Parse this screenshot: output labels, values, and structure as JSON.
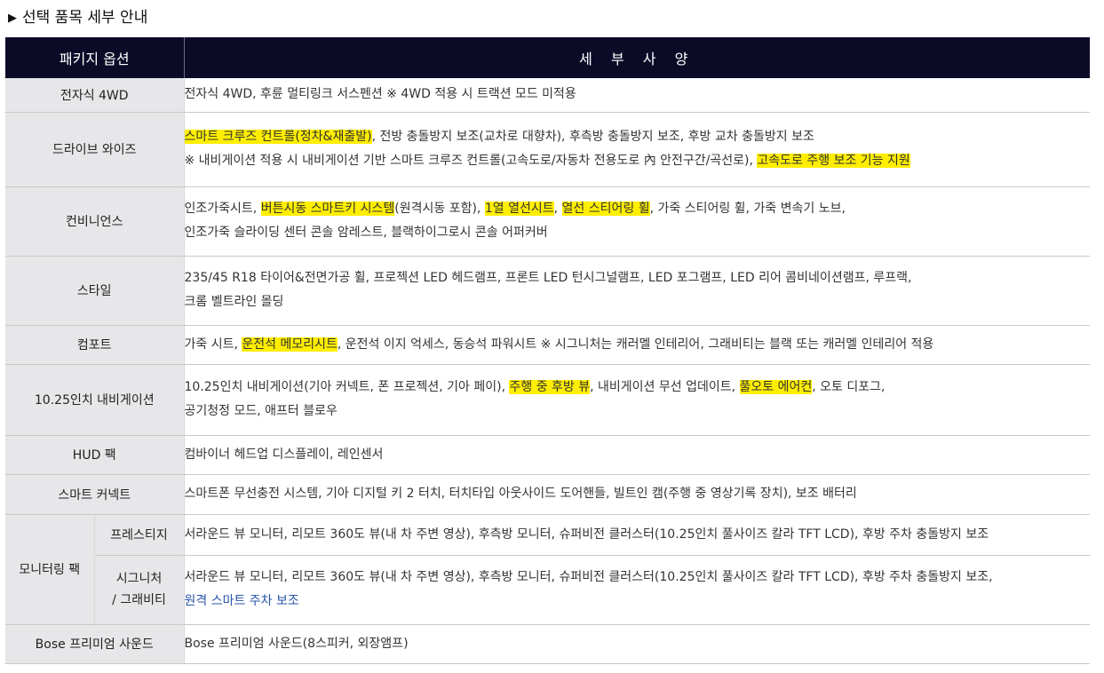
{
  "title": "선택 품목 세부 안내",
  "header": {
    "option": "패키지 옵션",
    "spec": "세 부 사 양"
  },
  "rows": {
    "r1": {
      "name": "전자식 4WD",
      "l1": "전자식 4WD, 후륜 멀티링크 서스펜션  ※ 4WD 적용 시 트랙션 모드 미적용"
    },
    "r2": {
      "name": "드라이브 와이즈",
      "l1a": "스마트 크루즈 컨트롤(정차&재출발)",
      "l1b": ", 전방 충돌방지 보조(교차로 대향차), 후측방 충돌방지 보조, 후방 교차 충돌방지 보조",
      "l2a": "※ 내비게이션 적용 시 내비게이션 기반 스마트 크루즈 컨트롤(고속도로/자동차 전용도로 內 안전구간/곡선로), ",
      "l2b": "고속도로 주행 보조 기능 지원"
    },
    "r3": {
      "name": "컨비니언스",
      "l1a": "인조가죽시트, ",
      "l1b": "버튼시동 스마트키 시스템",
      "l1c": "(원격시동 포함), ",
      "l1d": "1열 열선시트",
      "l1e": ", ",
      "l1f": "열선 스티어링 휠",
      "l1g": ", 가죽 스티어링 휠, 가죽 변속기 노브,",
      "l2": "인조가죽 슬라이딩 센터 콘솔 암레스트, 블랙하이그로시 콘솔 어퍼커버"
    },
    "r4": {
      "name": "스타일",
      "l1": "235/45 R18 타이어&전면가공 휠, 프로젝션 LED 헤드램프, 프론트 LED 턴시그널램프, LED 포그램프, LED 리어 콤비네이션램프, 루프랙,",
      "l2": "크롬 벨트라인 몰딩"
    },
    "r5": {
      "name": "컴포트",
      "l1a": "가죽 시트, ",
      "l1b": "운전석 메모리시트",
      "l1c": ", 운전석 이지 억세스, 동승석 파워시트  ※ 시그니처는 캐러멜 인테리어, 그래비티는 블랙 또는 캐러멜 인테리어 적용"
    },
    "r6": {
      "name": "10.25인치 내비게이션",
      "l1a": "10.25인치 내비게이션(기아 커넥트, 폰 프로젝션, 기아 페이), ",
      "l1b": "주행 중 후방 뷰",
      "l1c": ", 내비게이션 무선 업데이트, ",
      "l1d": "풀오토 에어컨",
      "l1e": ", 오토 디포그,",
      "l2": "공기청정 모드, 애프터 블로우"
    },
    "r7": {
      "name": "HUD 팩",
      "l1": "컴바이너 헤드업 디스플레이, 레인센서"
    },
    "r8": {
      "name": "스마트 커넥트",
      "l1": "스마트폰 무선충전 시스템, 기아 디지털 키 2 터치, 터치타입 아웃사이드 도어핸들, 빌트인 캠(주행 중 영상기록 장치), 보조 배터리"
    },
    "r9": {
      "group": "모니터링 팩",
      "sub1": "프레스티지",
      "sub1_l1": "서라운드 뷰 모니터, 리모트 360도 뷰(내 차 주변 영상), 후측방 모니터, 슈퍼비전 클러스터(10.25인치 풀사이즈 칼라 TFT LCD), 후방 주차 충돌방지 보조",
      "sub2a": "시그니처",
      "sub2b": "/ 그래비티",
      "sub2_l1": "서라운드 뷰 모니터, 리모트 360도 뷰(내 차 주변 영상), 후측방 모니터, 슈퍼비전 클러스터(10.25인치 풀사이즈 칼라 TFT LCD), 후방 주차 충돌방지 보조,",
      "sub2_l2": "원격 스마트 주차 보조"
    },
    "r10": {
      "name": "Bose 프리미엄 사운드",
      "l1": "Bose 프리미엄 사운드(8스피커, 외장앰프)"
    }
  },
  "colors": {
    "header_bg": "#0b0b28",
    "label_bg": "#e7e7e9",
    "highlight": "#ffee00",
    "link_blue": "#2855a8"
  }
}
